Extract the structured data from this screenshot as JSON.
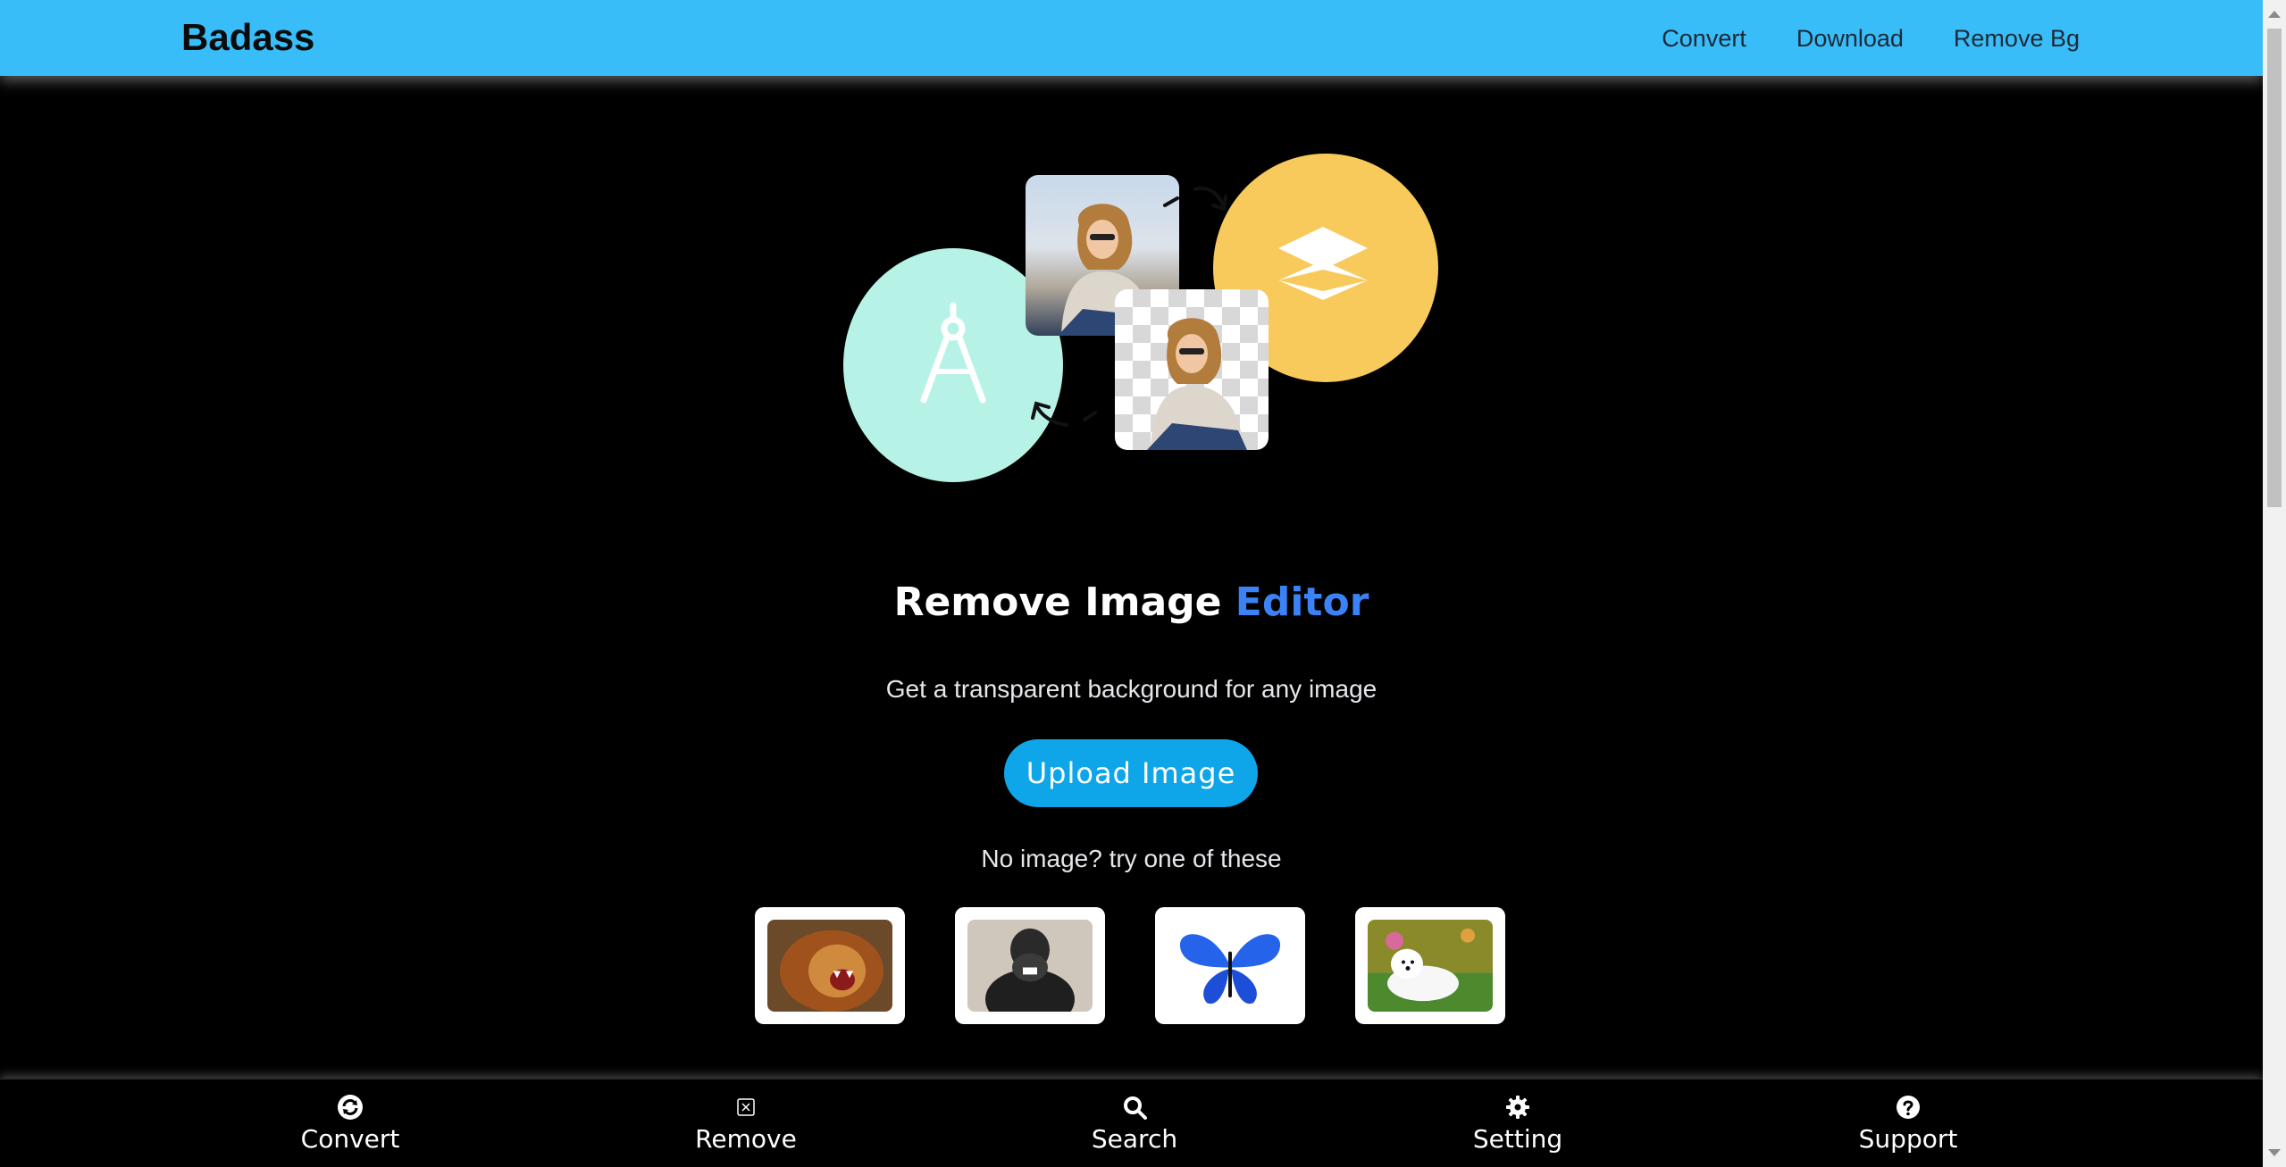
{
  "navbar": {
    "brand": "Badass",
    "links": [
      "Convert",
      "Download",
      "Remove Bg"
    ]
  },
  "hero": {
    "title_main": "Remove Image",
    "title_accent": "Editor",
    "subtitle": "Get a transparent background for any image",
    "upload_label": "Upload Image",
    "try_text": "No image? try one of these",
    "samples": [
      "lion",
      "gorilla",
      "butterfly",
      "dog"
    ]
  },
  "bottom_nav": {
    "items": [
      {
        "label": "Convert",
        "icon": "sync-icon"
      },
      {
        "label": "Remove",
        "icon": "remove-icon"
      },
      {
        "label": "Search",
        "icon": "search-icon"
      },
      {
        "label": "Setting",
        "icon": "gear-icon"
      },
      {
        "label": "Support",
        "icon": "help-icon"
      }
    ]
  },
  "colors": {
    "navbar_bg": "#38bdf8",
    "accent": "#3b82f6",
    "button": "#0ea5e9",
    "mint": "#b6f2e6",
    "yellow": "#f8c95b"
  }
}
